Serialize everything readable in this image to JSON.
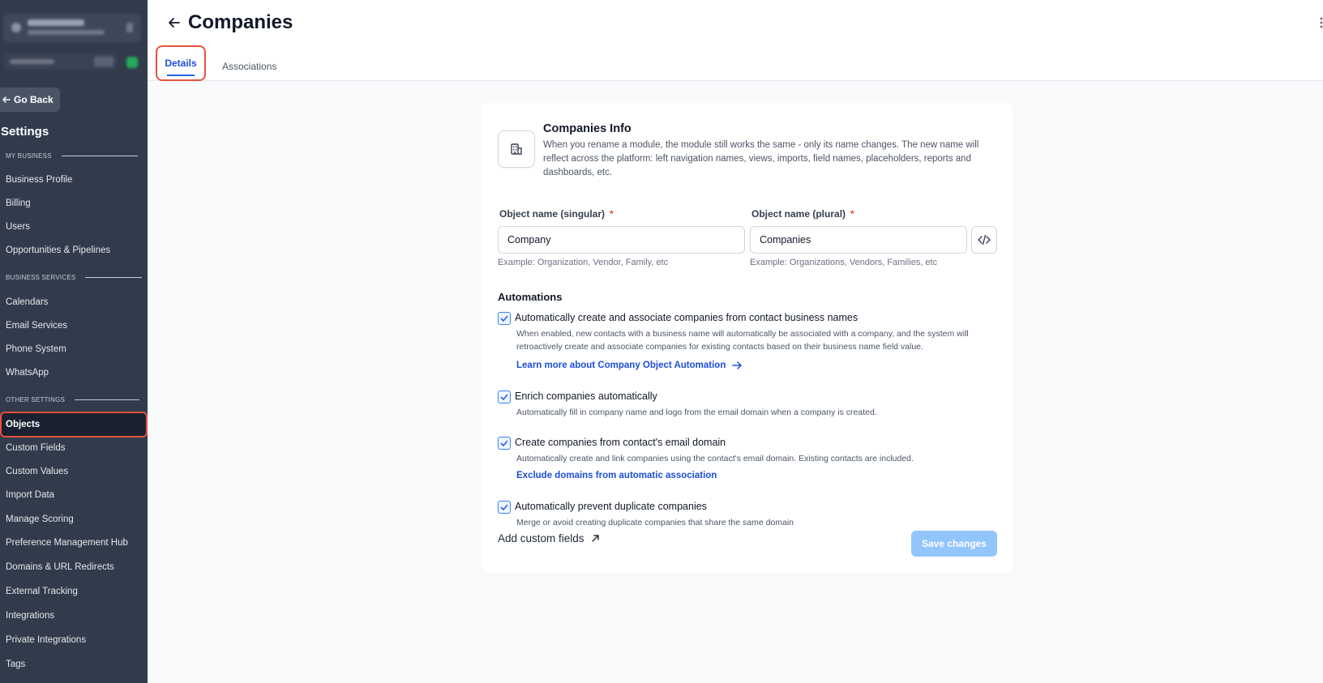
{
  "sidebar": {
    "go_back": "Go Back",
    "title": "Settings",
    "sections": {
      "my_business": "MY BUSINESS",
      "business_services": "BUSINESS SERVICES",
      "other_settings": "OTHER SETTINGS"
    },
    "items": {
      "business_profile": "Business Profile",
      "billing": "Billing",
      "users": "Users",
      "opportunities": "Opportunities & Pipelines",
      "calendars": "Calendars",
      "email_services": "Email Services",
      "phone_system": "Phone System",
      "whatsapp": "WhatsApp",
      "objects": "Objects",
      "custom_fields": "Custom Fields",
      "custom_values": "Custom Values",
      "import_data": "Import Data",
      "manage_scoring": "Manage Scoring",
      "preference_hub": "Preference Management Hub",
      "domains": "Domains & URL Redirects",
      "external_tracking": "External Tracking",
      "integrations": "Integrations",
      "private_integrations": "Private Integrations",
      "tags": "Tags"
    },
    "active_item": "Objects"
  },
  "header": {
    "title": "Companies",
    "tabs": {
      "details": "Details",
      "associations": "Associations"
    },
    "active_tab": "Details"
  },
  "card": {
    "info_title": "Companies Info",
    "info_desc": "When you rename a module, the module still works the same - only its name changes. The new name will reflect across the platform: left navigation names, views, imports, field names, placeholders, reports and dashboards, etc.",
    "singular_label": "Object name (singular)",
    "singular_value": "Company",
    "singular_hint": "Example: Organization, Vendor, Family, etc",
    "plural_label": "Object name (plural)",
    "plural_value": "Companies",
    "plural_hint": "Example: Organizations, Vendors, Families, etc",
    "required_mark": "*",
    "automations_title": "Automations",
    "options": [
      {
        "label": "Automatically create and associate companies from contact business names",
        "desc": "When enabled, new contacts with a business name will automatically be associated with a company, and the system will retroactively create and associate companies for existing contacts based on their business name field value.",
        "link": "Learn more about Company Object Automation",
        "checked": true
      },
      {
        "label": "Enrich companies automatically",
        "desc": "Automatically fill in company name and logo from the email domain when a company is created.",
        "checked": true
      },
      {
        "label": "Create companies from contact's email domain",
        "desc": "Automatically create and link companies using the contact's email domain. Existing contacts are included.",
        "link": "Exclude domains from automatic association",
        "checked": true
      },
      {
        "label": "Automatically prevent duplicate companies",
        "desc": "Merge or avoid creating duplicate companies that share the same domain",
        "checked": true
      }
    ],
    "add_custom_fields": "Add custom fields",
    "save_button": "Save changes"
  },
  "colors": {
    "sidebar_bg": "#323b4c",
    "accent": "#2563eb",
    "highlight": "#e5533d",
    "save_disabled": "#93c5fd"
  }
}
